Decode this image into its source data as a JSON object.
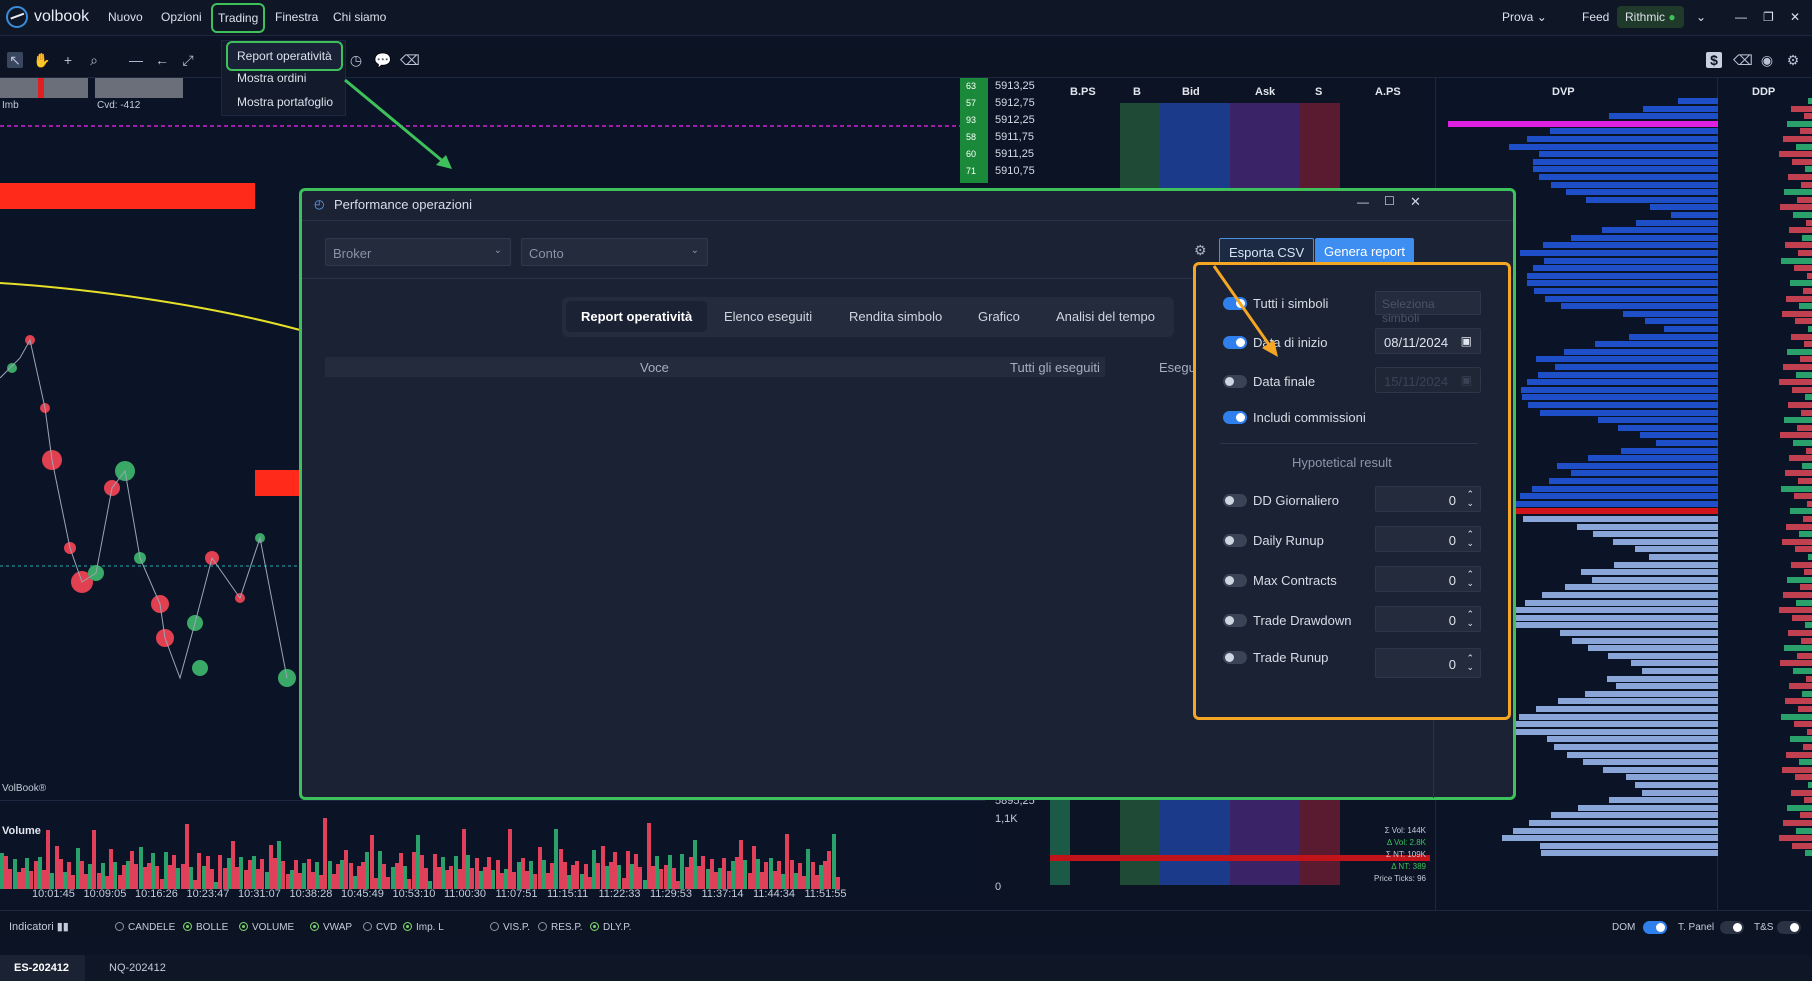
{
  "app": {
    "brand": "volbook",
    "watermark": "VolBook®"
  },
  "menu": {
    "items": [
      "Nuovo",
      "Opzioni",
      "Trading",
      "Finestra",
      "Chi siamo"
    ],
    "right": {
      "account": "Prova",
      "feed_label": "Feed",
      "feed_name": "Rithmic"
    }
  },
  "trading_menu": {
    "items": [
      "Report operatività",
      "Mostra ordini",
      "Mostra portafoglio"
    ]
  },
  "chart": {
    "imb_label": "Imb",
    "cvd_label": "Cvd: -412",
    "volume_label": "Volume",
    "volume_axis": [
      "1,1K",
      "0"
    ],
    "time_ticks": [
      "10:01:45",
      "10:09:05",
      "10:16:26",
      "10:23:47",
      "10:31:07",
      "10:38:28",
      "10:45:49",
      "10:53:10",
      "11:00:30",
      "11:07:51",
      "11:15:11",
      "11:22:33",
      "11:29:53",
      "11:37:14",
      "11:44:34",
      "11:51:55"
    ]
  },
  "ladder": {
    "headers": [
      "B.PS",
      "B",
      "Bid",
      "Ask",
      "S",
      "A.PS"
    ],
    "prices": [
      "5913,25",
      "5912,75",
      "5912,25",
      "5911,75",
      "5911,25",
      "5910,75"
    ],
    "left_values": [
      "63",
      "57",
      "93",
      "58",
      "60",
      "71"
    ],
    "bottom_price": "5895,25",
    "stats": [
      "Σ Vol: 144K",
      "Δ Vol: 2.8K",
      "Σ NT: 109K",
      "Δ NT: 389",
      "Price Ticks: 96"
    ]
  },
  "profile": {
    "dvp_label": "DVP",
    "ddp_label": "DDP"
  },
  "dialog": {
    "title": "Performance operazioni",
    "broker_placeholder": "Broker",
    "account_placeholder": "Conto",
    "export_button": "Esporta CSV",
    "report_button": "Genera report",
    "tabs": [
      "Report operatività",
      "Elenco eseguiti",
      "Rendita simbolo",
      "Grafico",
      "Analisi del tempo"
    ],
    "columns": [
      "Voce",
      "Tutti gli eseguiti",
      "Esegu"
    ]
  },
  "settings": {
    "all_symbols": {
      "label": "Tutti i simboli",
      "enabled": true,
      "button": "Seleziona simboli"
    },
    "start_date": {
      "label": "Data di inizio",
      "enabled": true,
      "value": "08/11/2024"
    },
    "end_date": {
      "label": "Data finale",
      "enabled": false,
      "value": "15/11/2024"
    },
    "include_fees": {
      "label": "Includi commissioni",
      "enabled": true
    },
    "section_title": "Hypotetical result",
    "limits": [
      {
        "label": "DD Giornaliero",
        "value": "0"
      },
      {
        "label": "Daily Runup",
        "value": "0"
      },
      {
        "label": "Max Contracts",
        "value": "0"
      },
      {
        "label": "Trade Drawdown",
        "value": "0"
      },
      {
        "label": "Trade Runup",
        "value": "0"
      }
    ]
  },
  "indicators": {
    "label": "Indicatori",
    "items": [
      {
        "name": "CANDELE",
        "on": false
      },
      {
        "name": "BOLLE",
        "on": true
      },
      {
        "name": "VOLUME",
        "on": true
      },
      {
        "name": "VWAP",
        "on": true
      },
      {
        "name": "CVD",
        "on": false
      },
      {
        "name": "Imp. L",
        "on": true
      },
      {
        "name": "VIS.P.",
        "on": false
      },
      {
        "name": "RES.P.",
        "on": false
      },
      {
        "name": "DLY.P.",
        "on": true
      }
    ],
    "right": [
      "DOM",
      "T. Panel",
      "T&S"
    ]
  },
  "symbols": [
    "ES-202412",
    "NQ-202412"
  ],
  "colors": {
    "accent": "#2f80ed",
    "highlight_green": "#3ec15b",
    "highlight_orange": "#f5a623"
  }
}
